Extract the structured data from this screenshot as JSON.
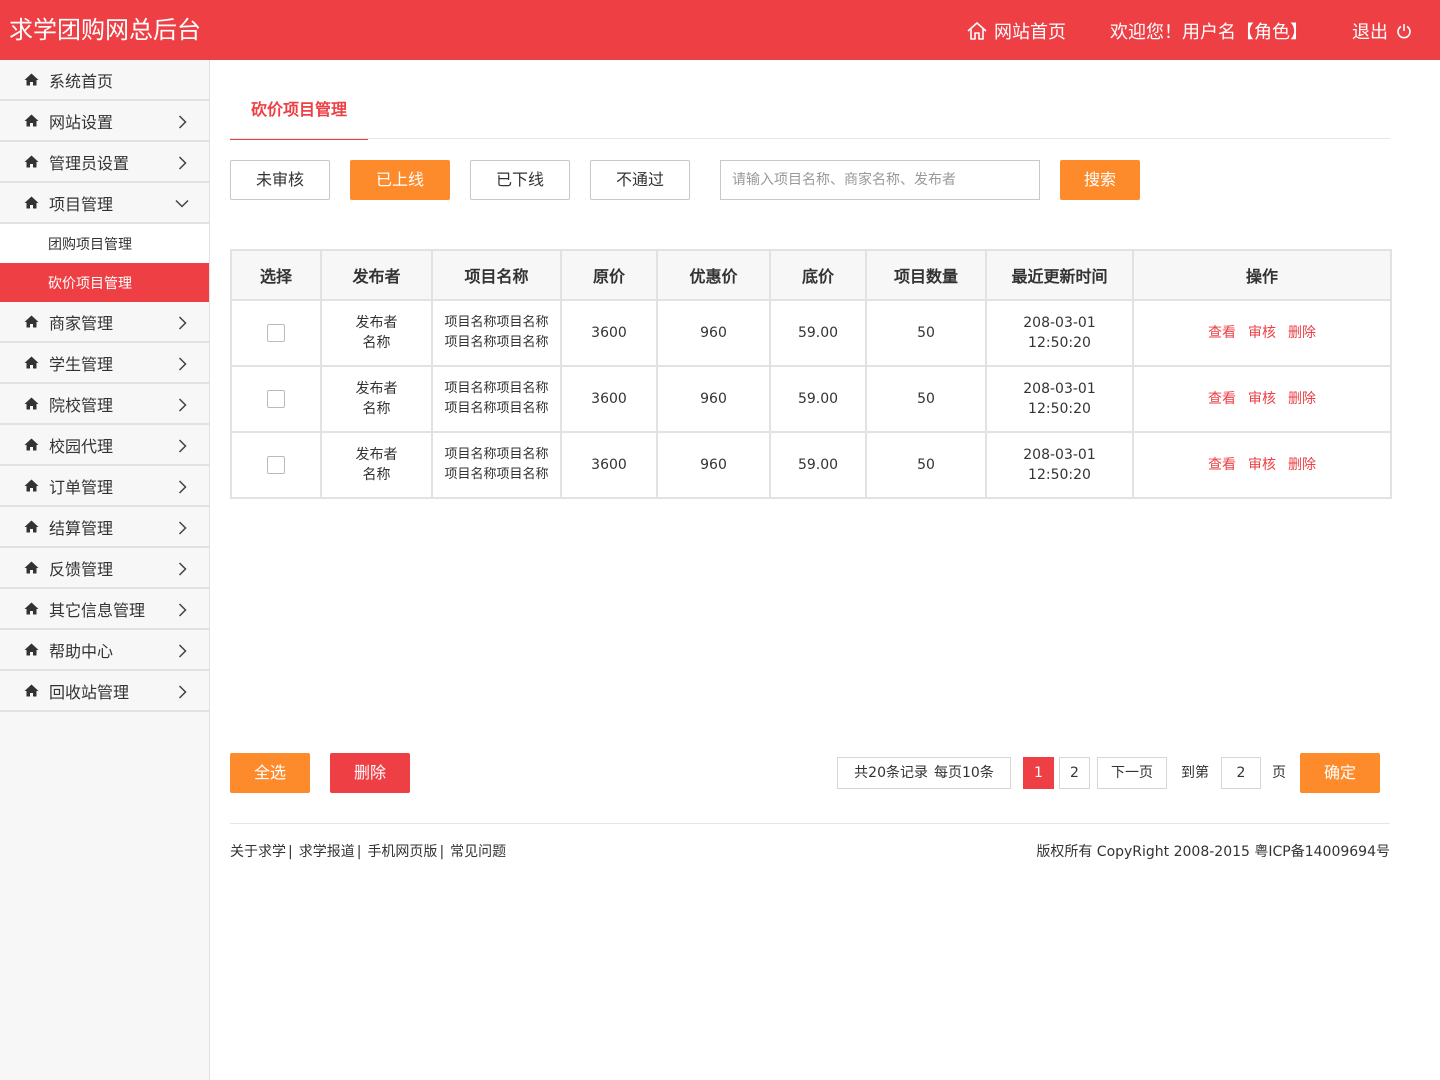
{
  "header": {
    "title": "求学团购网总后台",
    "home_link": "网站首页",
    "welcome": "欢迎您！用户名【角色】",
    "logout": "退出"
  },
  "sidebar": {
    "items": [
      {
        "label": "系统首页"
      },
      {
        "label": "网站设置"
      },
      {
        "label": "管理员设置"
      },
      {
        "label": "项目管理"
      },
      {
        "label": "商家管理"
      },
      {
        "label": "学生管理"
      },
      {
        "label": "院校管理"
      },
      {
        "label": "校园代理"
      },
      {
        "label": "订单管理"
      },
      {
        "label": "结算管理"
      },
      {
        "label": "反馈管理"
      },
      {
        "label": "其它信息管理"
      },
      {
        "label": "帮助中心"
      },
      {
        "label": "回收站管理"
      }
    ],
    "sub_items": [
      {
        "label": "团购项目管理"
      },
      {
        "label": "砍价项目管理",
        "active": true
      }
    ]
  },
  "page": {
    "tab": "砍价项目管理"
  },
  "filters": {
    "buttons": [
      "未审核",
      "已上线",
      "已下线",
      "不通过"
    ],
    "active": "已上线",
    "search_placeholder": "请输入项目名称、商家名称、发布者",
    "search_button": "搜索"
  },
  "table": {
    "headers": [
      "选择",
      "发布者",
      "项目名称",
      "原价",
      "优惠价",
      "底价",
      "项目数量",
      "最近更新时间",
      "操作"
    ],
    "rows": [
      {
        "publisher_1": "发布者",
        "publisher_2": "名称",
        "name_1": "项目名称项目名称",
        "name_2": "项目名称项目名称",
        "orig": "3600",
        "disc": "960",
        "floor": "59.00",
        "qty": "50",
        "date": "208-03-01",
        "time": "12:50:20"
      },
      {
        "publisher_1": "发布者",
        "publisher_2": "名称",
        "name_1": "项目名称项目名称",
        "name_2": "项目名称项目名称",
        "orig": "3600",
        "disc": "960",
        "floor": "59.00",
        "qty": "50",
        "date": "208-03-01",
        "time": "12:50:20"
      },
      {
        "publisher_1": "发布者",
        "publisher_2": "名称",
        "name_1": "项目名称项目名称",
        "name_2": "项目名称项目名称",
        "orig": "3600",
        "disc": "960",
        "floor": "59.00",
        "qty": "50",
        "date": "208-03-01",
        "time": "12:50:20"
      }
    ],
    "actions": [
      "查看",
      "审核",
      "删除"
    ]
  },
  "bulk": {
    "select_all": "全选",
    "delete": "删除"
  },
  "pagination": {
    "total": "共20条记录",
    "per_page": "每页10条",
    "pages": [
      "1",
      "2"
    ],
    "current": "1",
    "next": "下一页",
    "goto_label": "到第",
    "goto_value": "2",
    "page_unit": "页",
    "confirm": "确定"
  },
  "footer": {
    "links": [
      "关于求学",
      "求学报道",
      "手机网页版",
      "常见问题"
    ],
    "copyright": "版权所有 CopyRight 2008-2015 粤ICP备14009694号"
  },
  "colors": {
    "primary_red": "#ee3f45",
    "accent_orange": "#fd8a2b"
  }
}
